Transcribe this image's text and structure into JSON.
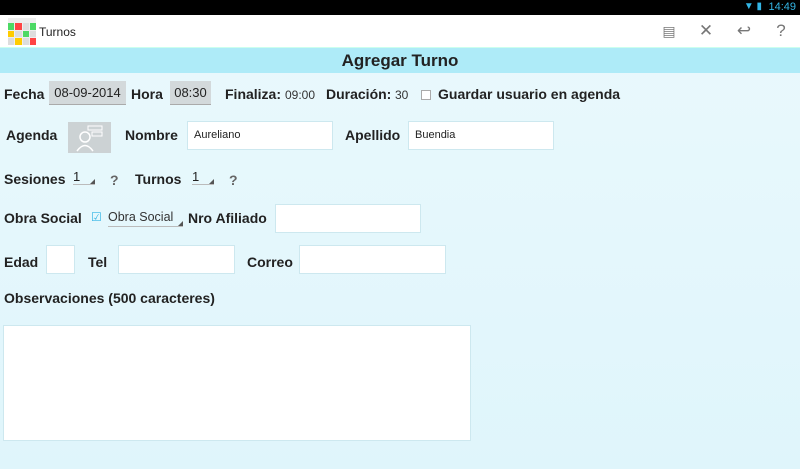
{
  "status": {
    "time": "14:49",
    "icons": "wifi battery"
  },
  "app": {
    "title": "Turnos",
    "logo_colors": [
      "#4cd964",
      "#f44",
      "#ddd",
      "#4cd964",
      "#fc0",
      "#ddd",
      "#4cd964",
      "#ddd",
      "#ddd",
      "#fc0",
      "#ddd",
      "#f44"
    ]
  },
  "actions": {
    "save": "💾",
    "close": "✕",
    "undo": "↩",
    "help": "?"
  },
  "form": {
    "title": "Agregar Turno",
    "fecha_label": "Fecha",
    "fecha_value": "08-09-2014",
    "hora_label": "Hora",
    "hora_value": "08:30",
    "finaliza_label": "Finaliza:",
    "finaliza_value": "09:00",
    "duracion_label": "Duración:",
    "duracion_value": "30",
    "guardar_label": "Guardar usuario en agenda",
    "agenda_label": "Agenda",
    "nombre_label": "Nombre",
    "nombre_value": "Aureliano",
    "apellido_label": "Apellido",
    "apellido_value": "Buendia",
    "sesiones_label": "Sesiones",
    "sesiones_value": "1",
    "turnos_label": "Turnos",
    "turnos_value": "1",
    "help": "?",
    "obra_label": "Obra Social",
    "obra_value": "Obra Social",
    "afiliado_label": "Nro Afiliado",
    "afiliado_value": "",
    "edad_label": "Edad",
    "edad_value": "",
    "tel_label": "Tel",
    "tel_value": "",
    "correo_label": "Correo",
    "correo_value": "",
    "obs_label": "Observaciones (500 caracteres)",
    "obs_value": ""
  }
}
